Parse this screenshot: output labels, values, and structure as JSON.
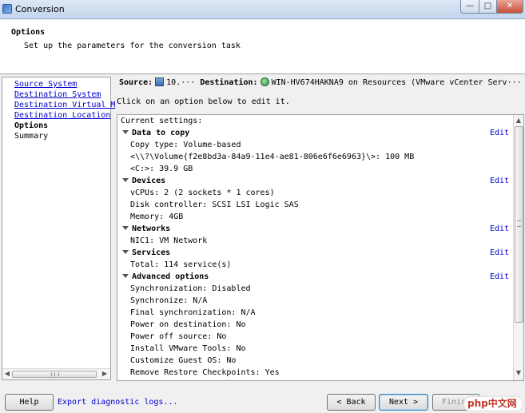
{
  "window": {
    "title": "Conversion"
  },
  "header": {
    "title": "Options",
    "subtitle": "Set up the parameters for the conversion task"
  },
  "nav": {
    "items": [
      {
        "label": "Source System",
        "state": "link"
      },
      {
        "label": "Destination System",
        "state": "link"
      },
      {
        "label": "Destination Virtual M",
        "state": "link"
      },
      {
        "label": "Destination Location",
        "state": "link"
      },
      {
        "label": "Options",
        "state": "current"
      },
      {
        "label": "Summary",
        "state": "plain"
      }
    ]
  },
  "summary_line": {
    "source_label": "Source:",
    "source_value": "10.···",
    "destination_label": "Destination:",
    "destination_value": "WIN-HV674HAKNA9 on Resources (VMware vCenter Serv···"
  },
  "instruction": "Click on an option below to edit it.",
  "settings": {
    "heading": "Current settings:",
    "edit_label": "Edit",
    "sections": [
      {
        "title": "Data to copy",
        "lines": [
          "Copy type: Volume-based",
          "<\\\\?\\Volume{f2e8bd3a-84a9-11e4-ae81-806e6f6e6963}\\>: 100 MB",
          "<C:>: 39.9 GB"
        ]
      },
      {
        "title": "Devices",
        "lines": [
          "vCPUs: 2 (2 sockets * 1 cores)",
          "Disk controller: SCSI LSI Logic SAS",
          "Memory: 4GB"
        ]
      },
      {
        "title": "Networks",
        "lines": [
          "NIC1: VM Network"
        ]
      },
      {
        "title": "Services",
        "lines": [
          "Total: 114 service(s)"
        ]
      },
      {
        "title": "Advanced options",
        "lines": [
          "Synchronization: Disabled",
          "Synchronize: N/A",
          "Final synchronization: N/A",
          "Power on destination: No",
          "Power off source: No",
          "Install VMware Tools: No",
          "Customize Guest OS: No",
          "Remove Restore Checkpoints: Yes"
        ]
      }
    ]
  },
  "footer": {
    "help": "Help",
    "export": "Export diagnostic logs...",
    "back": "< Back",
    "next": "Next >",
    "finish": "Finish",
    "watermark": "php中文网"
  },
  "colors": {
    "link": "#0000cc",
    "titlebar": "#c3d5ec",
    "accent_button": "#3c7fb1"
  }
}
